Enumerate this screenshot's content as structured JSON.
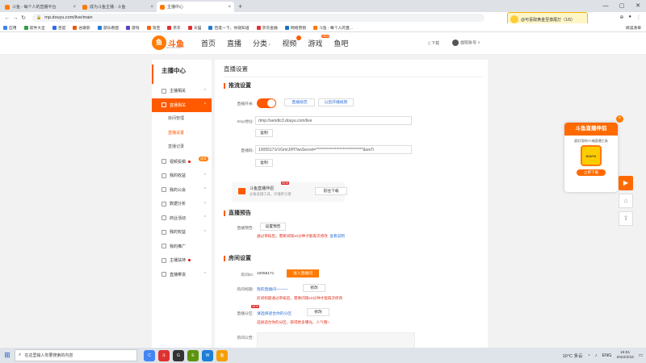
{
  "browser": {
    "tabs": [
      {
        "title": "斗鱼 - 每个人的直播平台",
        "active": false
      },
      {
        "title": "成为斗鱼主播 - 斗鱼",
        "active": false
      },
      {
        "title": "主播中心",
        "active": true
      }
    ],
    "new_tab": "+",
    "url": "mp.douyu.com/live/main",
    "promo": "@可喜取黄金至尊尾灯（1/5）",
    "bookmarks": [
      "应用",
      "软件大全",
      "百度",
      "谷歌影",
      "游乐看图",
      "游戏",
      "淘宝",
      "京东",
      "天猫",
      "百度一下，你就知道",
      "京东金融",
      "网络营销",
      "斗鱼 - 每个人的直..."
    ],
    "bookmarks_right": "阅读清单"
  },
  "site": {
    "logo_text": "斗鱼",
    "logo_sub": "DOUYU.COM",
    "nav": [
      "首页",
      "直播",
      "分类",
      "视频",
      "游戏",
      "鱼吧"
    ],
    "nav_badge": "NEW",
    "download": "下载",
    "username": "提取账号"
  },
  "sidebar": {
    "title": "主播中心",
    "items": [
      {
        "label": "主播相关",
        "caret": "^"
      },
      {
        "label": "直播相关",
        "caret": "^",
        "active": true
      },
      {
        "label": "房间管理",
        "sub": true
      },
      {
        "label": "直播设置",
        "sub": true,
        "on": true
      },
      {
        "label": "直播记录",
        "sub": true
      },
      {
        "label": "视频投稿",
        "tag": "送奖"
      },
      {
        "label": "我的收益",
        "caret": "^"
      },
      {
        "label": "我的公会",
        "caret": "^"
      },
      {
        "label": "数据分析",
        "caret": "^"
      },
      {
        "label": "商业活动",
        "caret": "^"
      },
      {
        "label": "我的权益",
        "caret": "^"
      },
      {
        "label": "我的推广"
      },
      {
        "label": "主播扶持",
        "red": true
      },
      {
        "label": "直播带货",
        "caret": "^"
      }
    ]
  },
  "main": {
    "title": "直播设置",
    "push": {
      "title": "推流设置",
      "switch_label": "直播开关:",
      "switch_on": true,
      "btn_rules": "直播规范",
      "btn_ways": "以后开播规则",
      "rtmp_label": "rtmp地址:",
      "rtmp_value": "rtmp://sendtc3.douyu.com/live",
      "copy": "复制",
      "code_label": "直播码:",
      "code_value": "10055171rVGmIJIPl?wsSecret=******************************&wsTi",
      "copy2": "复制"
    },
    "tool": {
      "name": "斗鱼直播伴侣",
      "desc": "必备直播工具，开播更方便",
      "new": "NEW",
      "download": "前往下载"
    },
    "preview": {
      "title": "直播预告",
      "label": "直播预告:",
      "btn": "设置预告",
      "note": "通过审核后，需要间隔10分钟才能再次修改",
      "link": "查看说明"
    },
    "room": {
      "title": "房间设置",
      "id_label": "房间ID:",
      "id_value": "10055171",
      "enter_btn": "进入直播间",
      "name_label": "房间标题:",
      "name_value": "我的直播间~~~~~",
      "edit": "修改",
      "name_note": "房间标题通过审核后，需要间隔10分钟才能再次修改",
      "cat_label": "直播分区:",
      "cat_value": "请选择适合你的分区",
      "cat_new": "NEW",
      "edit2": "修改",
      "cat_note": "选择适合你的分区，获得更多曝光，人气哦~",
      "notice_label": "房间公告:"
    }
  },
  "floating": {
    "title": "斗鱼直播伴侣",
    "desc": "超好用的PC端直播工具",
    "img_text": "DOUYU",
    "btn": "立即下载",
    "close": "×",
    "side": [
      "▶",
      "⌂",
      "⇪"
    ]
  },
  "taskbar": {
    "search": "在这里输入你要搜索的内容",
    "apps": [
      "C",
      "斗",
      "G",
      "E",
      "W",
      "鱼"
    ],
    "weather": "10°C 多云",
    "lang": "ENG",
    "time": "16:51",
    "date": "2022/2/16"
  }
}
